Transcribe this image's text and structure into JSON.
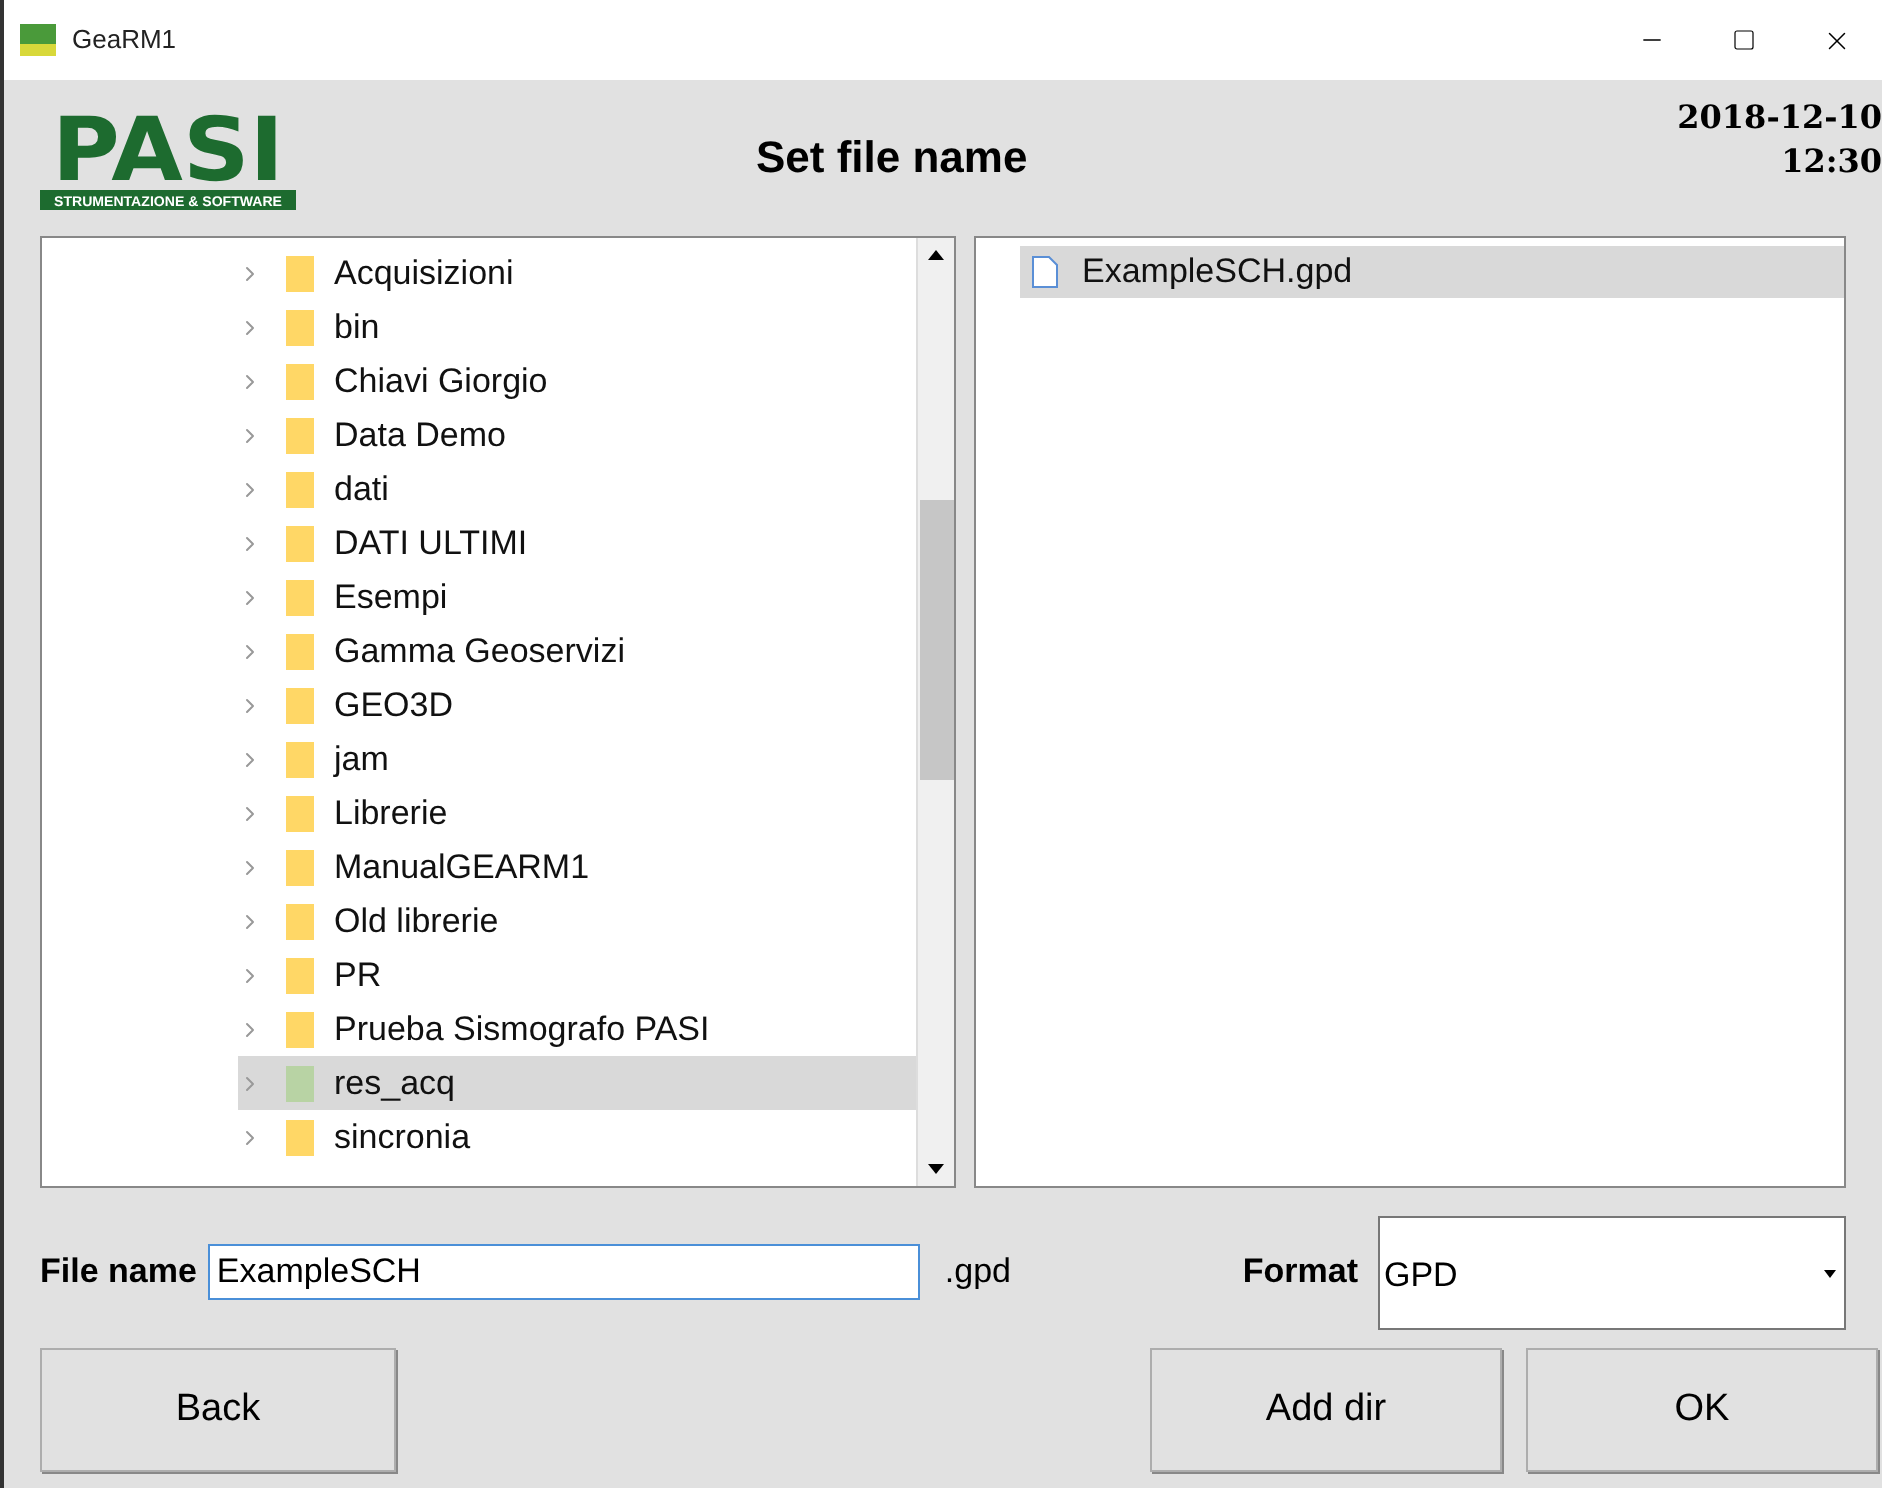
{
  "window": {
    "title": "GeaRM1"
  },
  "header": {
    "logo_text": "PASI",
    "logo_subtitle": "STRUMENTAZIONE & SOFTWARE",
    "title": "Set file name",
    "date": "2018-12-10",
    "time": "12:30"
  },
  "folders": [
    {
      "label": "Acquisizioni",
      "selected": false
    },
    {
      "label": "bin",
      "selected": false
    },
    {
      "label": "Chiavi Giorgio",
      "selected": false
    },
    {
      "label": "Data Demo",
      "selected": false
    },
    {
      "label": "dati",
      "selected": false
    },
    {
      "label": "DATI ULTIMI",
      "selected": false
    },
    {
      "label": "Esempi",
      "selected": false
    },
    {
      "label": "Gamma Geoservizi",
      "selected": false
    },
    {
      "label": "GEO3D",
      "selected": false
    },
    {
      "label": "jam",
      "selected": false
    },
    {
      "label": "Librerie",
      "selected": false
    },
    {
      "label": "ManualGEARM1",
      "selected": false
    },
    {
      "label": "Old librerie",
      "selected": false
    },
    {
      "label": "PR",
      "selected": false
    },
    {
      "label": "Prueba Sismografo PASI",
      "selected": false
    },
    {
      "label": "res_acq",
      "selected": true
    },
    {
      "label": "sincronia",
      "selected": false
    }
  ],
  "files": [
    {
      "label": "ExampleSCH.gpd",
      "selected": true
    }
  ],
  "file_name": {
    "label": "File name",
    "value": "ExampleSCH",
    "extension": ".gpd"
  },
  "format": {
    "label": "Format",
    "value": "GPD"
  },
  "buttons": {
    "back": "Back",
    "add_dir": "Add dir",
    "ok": "OK"
  }
}
